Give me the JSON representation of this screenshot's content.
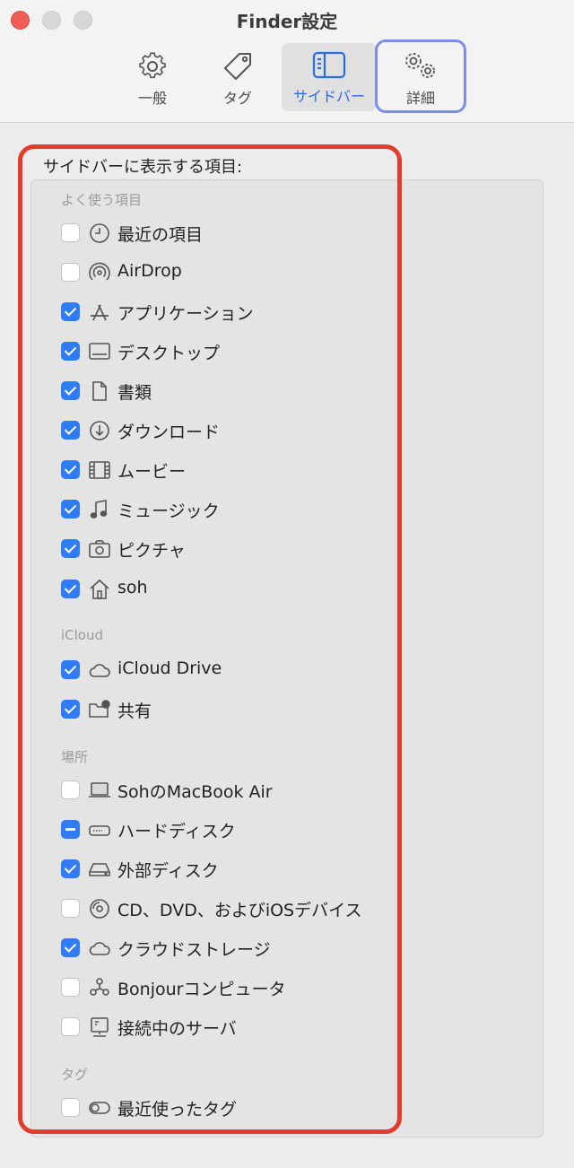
{
  "window": {
    "title": "Finder設定"
  },
  "tabs": [
    {
      "label": "一般",
      "icon": "gear-icon"
    },
    {
      "label": "タグ",
      "icon": "tag-icon"
    },
    {
      "label": "サイドバー",
      "icon": "sidebar-icon",
      "active": true
    },
    {
      "label": "詳細",
      "icon": "gears-icon"
    }
  ],
  "section_title": "サイドバーに表示する項目:",
  "groups": [
    {
      "header": "よく使う項目"
    },
    {
      "header": "iCloud"
    },
    {
      "header": "場所"
    },
    {
      "header": "タグ"
    }
  ],
  "items": [
    {
      "label": "最近の項目",
      "state": "off",
      "icon": "clock-icon"
    },
    {
      "label": "AirDrop",
      "state": "off",
      "icon": "airdrop-icon"
    },
    {
      "label": "アプリケーション",
      "state": "on",
      "icon": "applications-icon"
    },
    {
      "label": "デスクトップ",
      "state": "on",
      "icon": "desktop-icon"
    },
    {
      "label": "書類",
      "state": "on",
      "icon": "document-icon"
    },
    {
      "label": "ダウンロード",
      "state": "on",
      "icon": "download-icon"
    },
    {
      "label": "ムービー",
      "state": "on",
      "icon": "film-icon"
    },
    {
      "label": "ミュージック",
      "state": "on",
      "icon": "music-note-icon"
    },
    {
      "label": "ピクチャ",
      "state": "on",
      "icon": "camera-icon"
    },
    {
      "label": "soh",
      "state": "on",
      "icon": "home-icon"
    },
    {
      "label": "iCloud Drive",
      "state": "on",
      "icon": "cloud-icon"
    },
    {
      "label": "共有",
      "state": "on",
      "icon": "shared-folder-icon"
    },
    {
      "label": "SohのMacBook Air",
      "state": "off",
      "icon": "laptop-icon"
    },
    {
      "label": "ハードディスク",
      "state": "mixed",
      "icon": "hard-disk-icon"
    },
    {
      "label": "外部ディスク",
      "state": "on",
      "icon": "external-disk-icon"
    },
    {
      "label": "CD、DVD、およびiOSデバイス",
      "state": "off",
      "icon": "disc-icon"
    },
    {
      "label": "クラウドストレージ",
      "state": "on",
      "icon": "cloud-icon"
    },
    {
      "label": "Bonjourコンピュータ",
      "state": "off",
      "icon": "bonjour-icon"
    },
    {
      "label": "接続中のサーバ",
      "state": "off",
      "icon": "server-icon"
    },
    {
      "label": "最近使ったタグ",
      "state": "off",
      "icon": "tag-toggle-icon"
    }
  ],
  "colors": {
    "accent": "#2f7cf6",
    "highlight_red": "#e33b2c",
    "highlight_blue": "#7d8ee6"
  }
}
